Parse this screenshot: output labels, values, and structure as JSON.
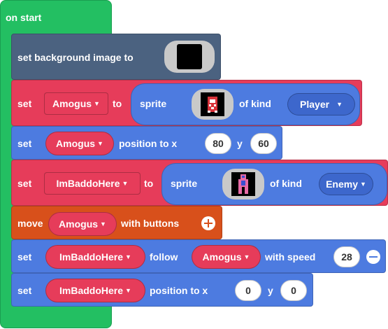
{
  "hat": {
    "label": "on start"
  },
  "blocks": {
    "bg": {
      "label": "set background image to",
      "image": "black-square-image"
    },
    "set_player": {
      "set": "set",
      "variable": "Amogus",
      "to": "to",
      "sprite": "sprite",
      "image": "player-sprite-image",
      "of_kind": "of kind",
      "kind": "Player"
    },
    "pos_player": {
      "set": "set",
      "variable": "Amogus",
      "position_to_x": "position to x",
      "x": "80",
      "y_label": "y",
      "y": "60"
    },
    "set_enemy": {
      "set": "set",
      "variable": "ImBaddoHere",
      "to": "to",
      "sprite": "sprite",
      "image": "enemy-sprite-image",
      "of_kind": "of kind",
      "kind": "Enemy"
    },
    "move": {
      "move": "move",
      "variable": "Amogus",
      "with_buttons": "with buttons",
      "icon": "plus-circle-icon"
    },
    "follow": {
      "set": "set",
      "variable": "ImBaddoHere",
      "follow": "follow",
      "target": "Amogus",
      "with_speed": "with speed",
      "speed": "28",
      "icon": "minus-circle-icon"
    },
    "pos_enemy": {
      "set": "set",
      "variable": "ImBaddoHere",
      "position_to_x": "position to x",
      "x": "0",
      "y_label": "y",
      "y": "0"
    }
  },
  "colors": {
    "event": "#23bf62",
    "scene": "#4b6280",
    "variables": "#e63c5a",
    "sprites": "#4d7be0",
    "controller": "#d8501b"
  }
}
